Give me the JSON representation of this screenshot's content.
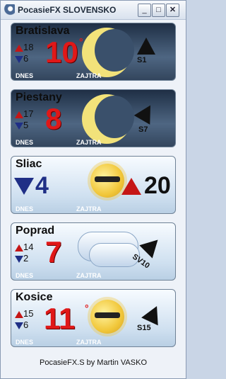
{
  "window": {
    "title": "PocasieFX SLOVENSKO",
    "buttons": {
      "minimize": "_",
      "maximize": "□",
      "close": "✕"
    }
  },
  "cards": [
    {
      "city": "Bratislava",
      "max": "18",
      "min": "6",
      "big": "10",
      "wind": "S1",
      "dnes": "DNES",
      "zajtra": "ZAJTRA"
    },
    {
      "city": "Piestany",
      "max": "17",
      "min": "5",
      "big": "8",
      "wind": "S7",
      "dnes": "DNES",
      "zajtra": "ZAJTRA"
    },
    {
      "city": "Sliac",
      "low": "4",
      "high": "20",
      "dnes": "DNES",
      "zajtra": "ZAJTRA"
    },
    {
      "city": "Poprad",
      "max": "14",
      "min": "2",
      "big": "7",
      "wind": "SV10",
      "dnes": "DNES",
      "zajtra": "ZAJTRA"
    },
    {
      "city": "Kosice",
      "max": "15",
      "min": "6",
      "big": "11",
      "wind": "S15",
      "dnes": "DNES",
      "zajtra": "ZAJTRA"
    }
  ],
  "footer": "PocasieFX.S by Martin VASKO",
  "colors": {
    "accent_red": "#e01818",
    "accent_blue": "#1f2f86"
  }
}
